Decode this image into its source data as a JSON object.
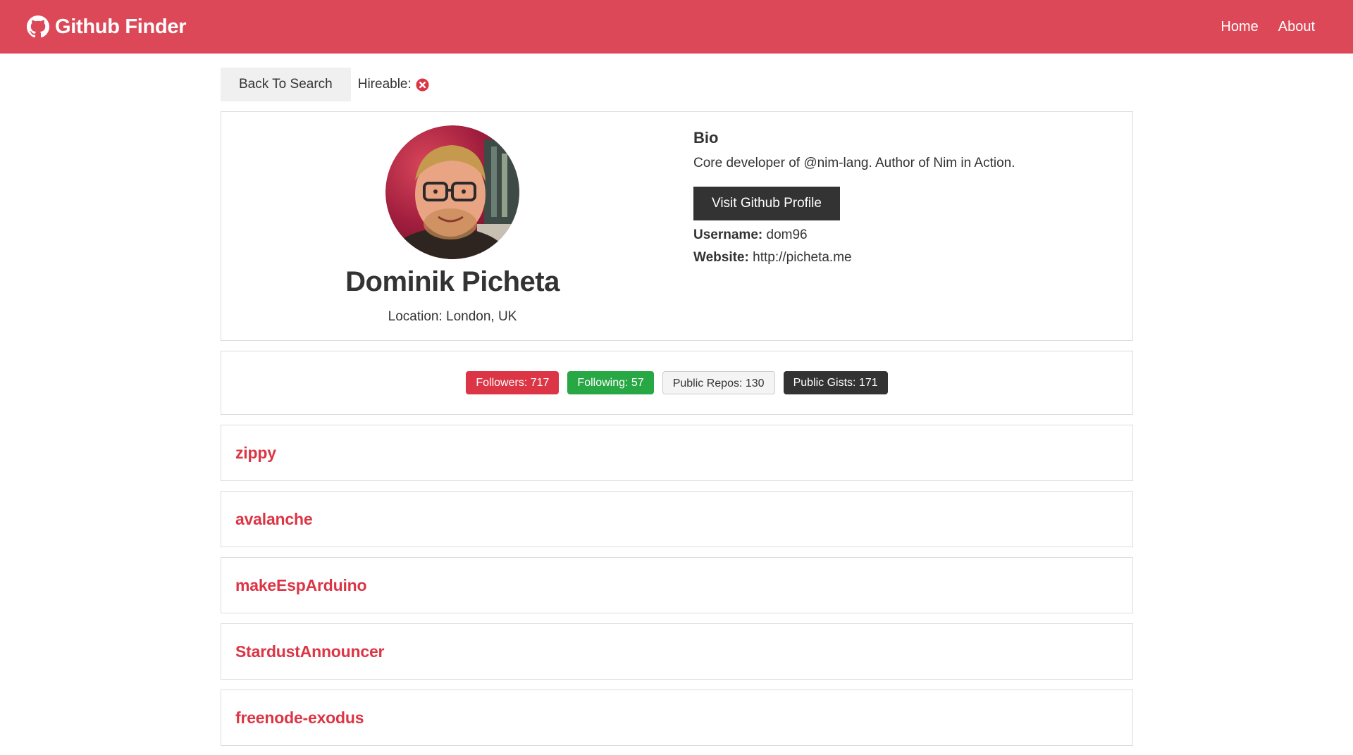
{
  "navbar": {
    "brand": "Github Finder",
    "links": [
      {
        "label": "Home"
      },
      {
        "label": "About"
      }
    ]
  },
  "actions": {
    "back_label": "Back To Search",
    "hireable_label": "Hireable:",
    "hireable_value": "x-circle-icon"
  },
  "profile": {
    "name": "Dominik Picheta",
    "location": "Location: London, UK",
    "bio_title": "Bio",
    "bio_text": "Core developer of @nim-lang. Author of Nim in Action.",
    "visit_label": "Visit Github Profile",
    "username_label": "Username:",
    "username": "dom96",
    "website_label": "Website:",
    "website": "http://picheta.me"
  },
  "stats": {
    "followers": "Followers: 717",
    "following": "Following: 57",
    "public_repos": "Public Repos: 130",
    "public_gists": "Public Gists: 171"
  },
  "repos": [
    {
      "name": "zippy"
    },
    {
      "name": "avalanche"
    },
    {
      "name": "makeEspArduino"
    },
    {
      "name": "StardustAnnouncer"
    },
    {
      "name": "freenode-exodus"
    }
  ],
  "colors": {
    "navbar": "#dc4857",
    "accent": "#dc3545",
    "success": "#28a745",
    "dark": "#333333"
  }
}
